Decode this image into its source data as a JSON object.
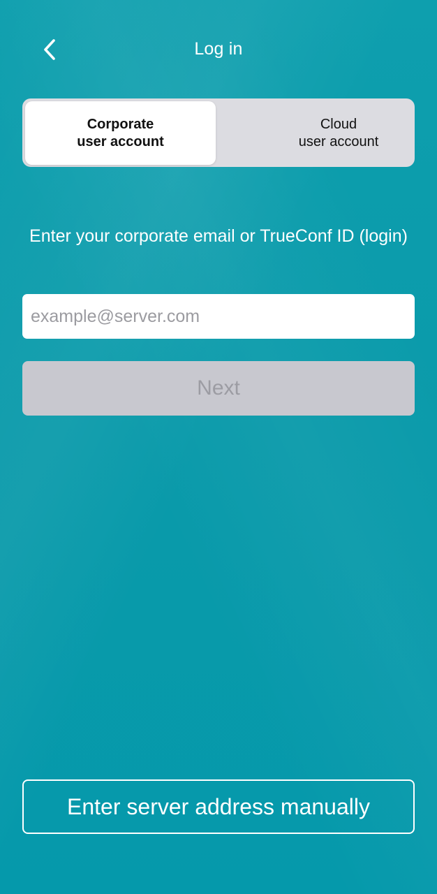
{
  "header": {
    "title": "Log in",
    "back_icon": "chevron-left-icon"
  },
  "account_switch": {
    "selected": "corporate",
    "options": [
      {
        "line1": "Corporate",
        "line2": "user account"
      },
      {
        "line1": "Cloud",
        "line2": "user account"
      }
    ]
  },
  "login": {
    "instruction": "Enter your corporate email or TrueConf ID (login)",
    "email_value": "",
    "email_placeholder": "example@server.com",
    "next_label": "Next"
  },
  "footer": {
    "manual_label": "Enter server address manually"
  },
  "colors": {
    "background": "#0C9BAB",
    "segment_track": "#DCDCE1",
    "disabled_button": "#C8C8CF",
    "disabled_text": "#9C9CA3"
  }
}
